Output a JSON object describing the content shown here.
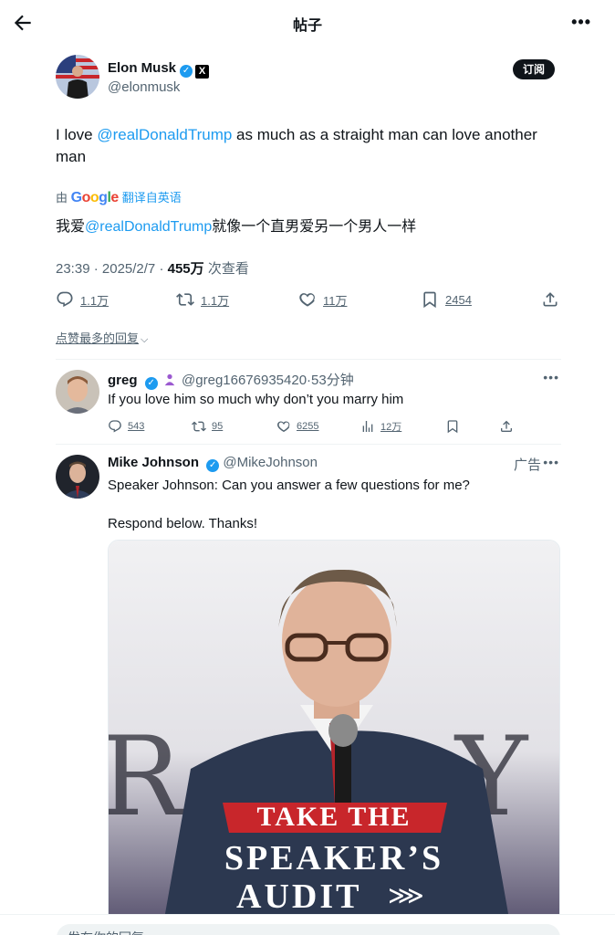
{
  "header": {
    "title": "帖子",
    "back_icon": "arrow-left-icon",
    "more_icon": "more-horizontal-icon",
    "more_text": "•••"
  },
  "post": {
    "author_name": "Elon Musk",
    "author_handle": "@elonmusk",
    "subscribe_label": "订阅",
    "text_before": "I love ",
    "mention": "@realDonaldTrump",
    "text_after": " as much as a straight man can love another man",
    "translate_prefix": "由",
    "translate_brand": "Google",
    "translate_link": "翻译自英语",
    "translated_before": "我爱",
    "translated_mention": "@realDonaldTrump",
    "translated_after": "就像一个直男爱另一个男人一样",
    "time": "23:39",
    "date": "2025/2/7",
    "views": "455万",
    "views_label": "次查看",
    "replies": "1.1万",
    "reposts": "1.1万",
    "likes": "11万",
    "bookmarks": "2454"
  },
  "sort_label": "点赞最多的回复",
  "replies": [
    {
      "name": "greg",
      "handle": "@greg16676935420",
      "time": "53分钟",
      "text": "If you love him so much why don’t you marry him",
      "replies": "543",
      "reposts": "95",
      "likes": "6255",
      "views": "12万",
      "more": "•••"
    }
  ],
  "ad": {
    "name": "Mike Johnson",
    "handle": "@MikeJohnson",
    "ad_label": "广告",
    "more": "•••",
    "text": "Speaker Johnson: Can you answer a few questions for me?\n\nRespond below. Thanks!",
    "banner_line1": "TAKE THE",
    "banner_line2": "SPEAKER’S",
    "banner_line3": "AUDIT",
    "banner_arrows": "⋙"
  },
  "compose": {
    "placeholder": "发布你的回复"
  },
  "colors": {
    "accent": "#1d9bf0",
    "text": "#0f1419",
    "muted": "#536471",
    "banner_red": "#c8262b"
  }
}
